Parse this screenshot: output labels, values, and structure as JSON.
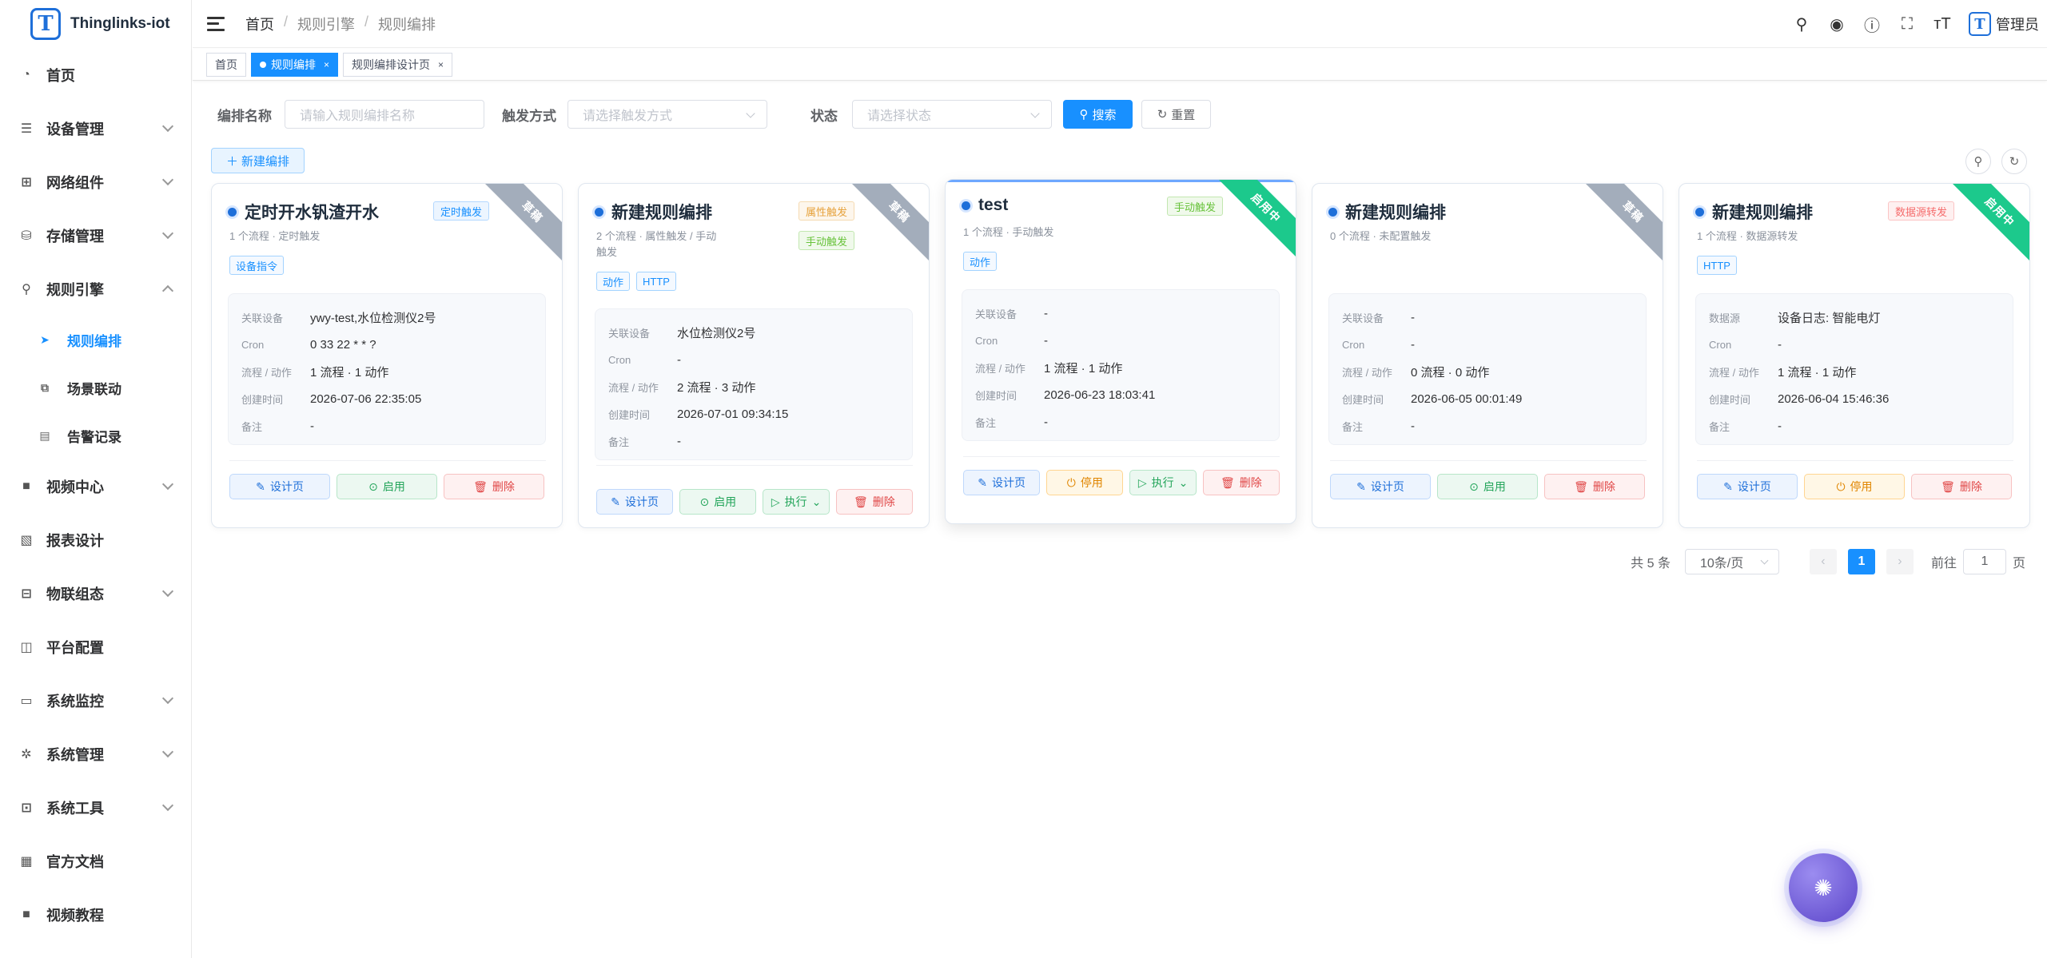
{
  "app": {
    "title": "Thinglinks-iot",
    "logo_letter": "T"
  },
  "sidebar": {
    "items": [
      {
        "label": "首页",
        "icon": "dashboard-icon"
      },
      {
        "label": "设备管理",
        "icon": "device-icon"
      },
      {
        "label": "网络组件",
        "icon": "network-icon"
      },
      {
        "label": "存储管理",
        "icon": "storage-icon"
      },
      {
        "label": "规则引擎",
        "icon": "rule-icon"
      },
      {
        "label": "视频中心",
        "icon": "video-icon"
      },
      {
        "label": "报表设计",
        "icon": "report-icon"
      },
      {
        "label": "物联组态",
        "icon": "config-icon"
      },
      {
        "label": "平台配置",
        "icon": "platform-icon"
      },
      {
        "label": "系统监控",
        "icon": "monitor-icon"
      },
      {
        "label": "系统管理",
        "icon": "settings-icon"
      },
      {
        "label": "系统工具",
        "icon": "tools-icon"
      },
      {
        "label": "官方文档",
        "icon": "doc-icon"
      },
      {
        "label": "视频教程",
        "icon": "tutorial-icon"
      }
    ],
    "sub_items": [
      {
        "label": "规则编排",
        "icon": "send-icon",
        "active": true
      },
      {
        "label": "场景联动",
        "icon": "scene-icon"
      },
      {
        "label": "告警记录",
        "icon": "alarm-icon"
      }
    ]
  },
  "header": {
    "breadcrumbs": [
      "首页",
      "规则引擎",
      "规则编排"
    ],
    "user": "管理员",
    "icons": [
      "search-icon",
      "github-icon",
      "help-icon",
      "fullscreen-icon",
      "font-size-icon"
    ]
  },
  "tabs": [
    {
      "label": "首页"
    },
    {
      "label": "规则编排",
      "close": "×"
    },
    {
      "label": "规则编排设计页",
      "close": "×"
    }
  ],
  "filters": {
    "name_label": "编排名称",
    "name_placeholder": "请输入规则编排名称",
    "trigger_label": "触发方式",
    "trigger_placeholder": "请选择触发方式",
    "status_label": "状态",
    "status_placeholder": "请选择状态",
    "search_btn": "搜索",
    "reset_btn": "重置"
  },
  "new_btn": "新建编排",
  "cards": [
    {
      "title": "定时开水钒渣开水",
      "meta_line1": "1 个流程 · 定时触发",
      "meta_line2": "",
      "ribbon": "草稿",
      "badges": [
        "定时触发"
      ],
      "tags": [
        "设备指令"
      ],
      "rows": [
        {
          "k": "关联设备",
          "v": "ywy-test,水位检测仪2号"
        },
        {
          "k": "Cron",
          "v": "0 33 22 * * ?"
        },
        {
          "k": "流程 / 动作",
          "v": "1 流程 · 1 动作"
        },
        {
          "k": "创建时间",
          "v": "2026-07-06 22:35:05"
        },
        {
          "k": "备注",
          "v": "-"
        }
      ],
      "actions": [
        "设计页",
        "启用",
        "删除"
      ]
    },
    {
      "title": "新建规则编排",
      "meta_line1": "2 个流程 · 属性触发 / 手动",
      "meta_line2": "触发",
      "ribbon": "草稿",
      "badges": [
        "属性触发",
        "手动触发"
      ],
      "tags": [
        "动作",
        "HTTP"
      ],
      "rows": [
        {
          "k": "关联设备",
          "v": "水位检测仪2号"
        },
        {
          "k": "Cron",
          "v": "-"
        },
        {
          "k": "流程 / 动作",
          "v": "2 流程 · 3 动作"
        },
        {
          "k": "创建时间",
          "v": "2026-07-01 09:34:15"
        },
        {
          "k": "备注",
          "v": "-"
        }
      ],
      "actions": [
        "设计页",
        "启用",
        "执行",
        "删除"
      ]
    },
    {
      "title": "test",
      "meta_line1": "1 个流程 · 手动触发",
      "meta_line2": "",
      "ribbon": "启用中",
      "badges": [
        "手动触发"
      ],
      "tags": [
        "动作"
      ],
      "rows": [
        {
          "k": "关联设备",
          "v": "-"
        },
        {
          "k": "Cron",
          "v": "-"
        },
        {
          "k": "流程 / 动作",
          "v": "1 流程 · 1 动作"
        },
        {
          "k": "创建时间",
          "v": "2026-06-23 18:03:41"
        },
        {
          "k": "备注",
          "v": "-"
        }
      ],
      "actions": [
        "设计页",
        "停用",
        "执行",
        "删除"
      ]
    },
    {
      "title": "新建规则编排",
      "meta_line1": "0 个流程 · 未配置触发",
      "meta_line2": "",
      "ribbon": "草稿",
      "badges": [],
      "tags": [],
      "rows": [
        {
          "k": "关联设备",
          "v": "-"
        },
        {
          "k": "Cron",
          "v": "-"
        },
        {
          "k": "流程 / 动作",
          "v": "0 流程 · 0 动作"
        },
        {
          "k": "创建时间",
          "v": "2026-06-05 00:01:49"
        },
        {
          "k": "备注",
          "v": "-"
        }
      ],
      "actions": [
        "设计页",
        "启用",
        "删除"
      ]
    },
    {
      "title": "新建规则编排",
      "meta_line1": "1 个流程 · 数据源转发",
      "meta_line2": "",
      "ribbon": "启用中",
      "badges": [
        "数据源转发"
      ],
      "tags": [
        "HTTP"
      ],
      "rows": [
        {
          "k": "数据源",
          "v": "设备日志: 智能电灯"
        },
        {
          "k": "Cron",
          "v": "-"
        },
        {
          "k": "流程 / 动作",
          "v": "1 流程 · 1 动作"
        },
        {
          "k": "创建时间",
          "v": "2026-06-04 15:46:36"
        },
        {
          "k": "备注",
          "v": "-"
        }
      ],
      "actions": [
        "设计页",
        "停用",
        "删除"
      ]
    }
  ],
  "pagination": {
    "total": "共 5 条",
    "page_size": "10条/页",
    "current": "1",
    "goto_label": "前往",
    "goto_value": "1",
    "page_suffix": "页"
  },
  "colors": {
    "primary": "#1890ff",
    "ribbon_draft": "#a3adbb",
    "ribbon_enabled": "#1cc98c"
  }
}
